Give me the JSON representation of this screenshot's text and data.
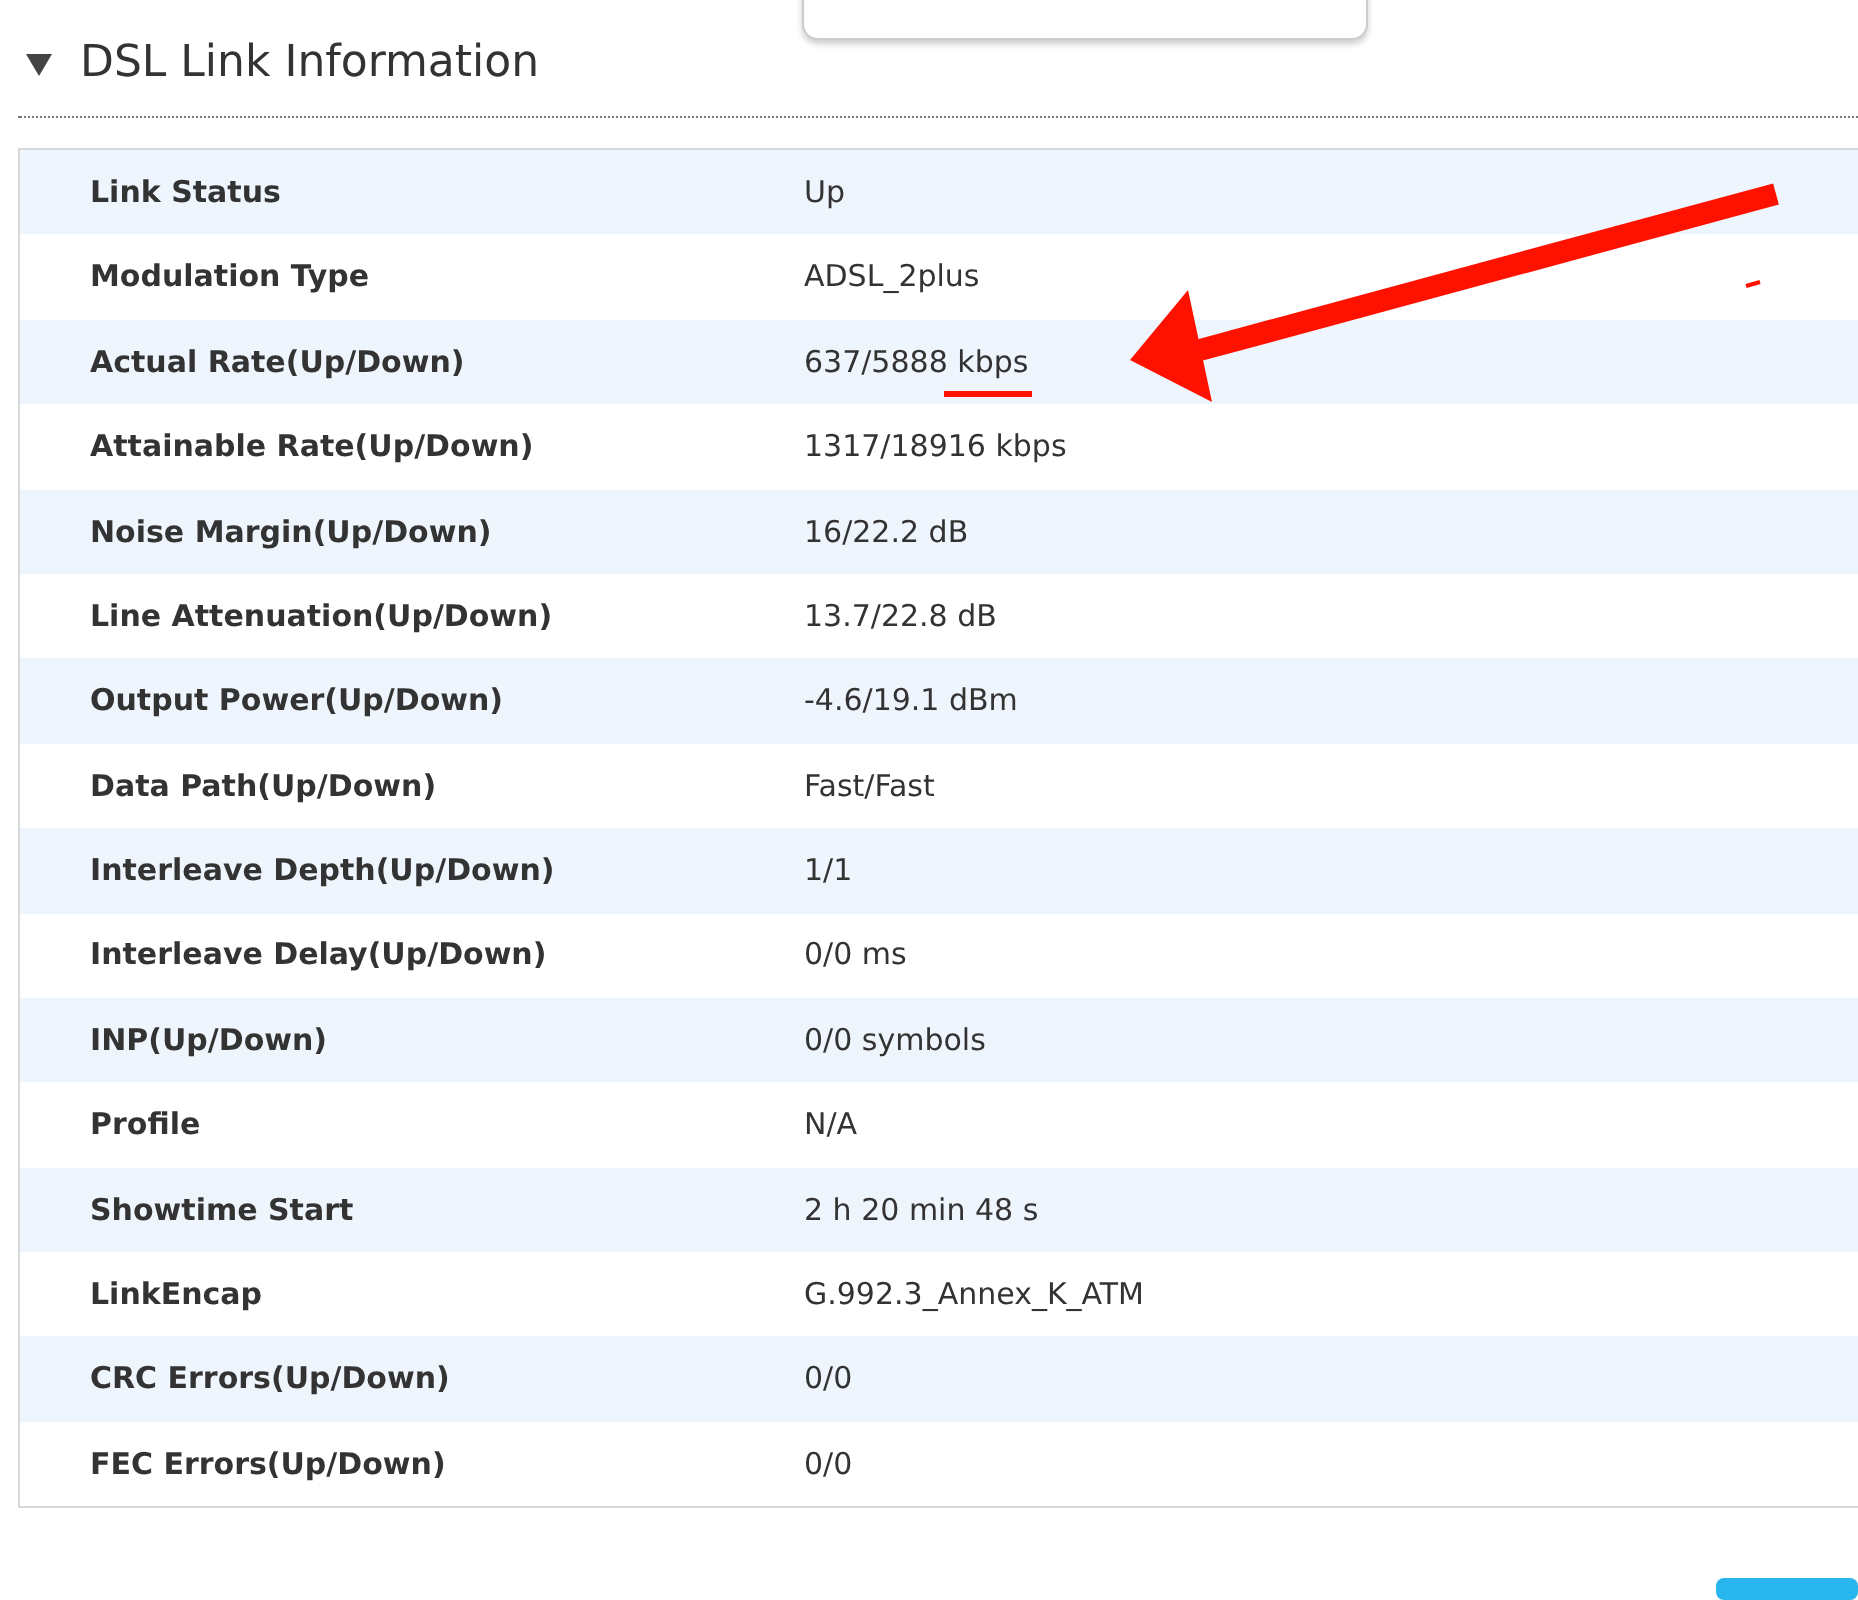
{
  "section": {
    "title": "DSL Link Information",
    "expanded": true
  },
  "rows": [
    {
      "label": "Link Status",
      "value": "Up"
    },
    {
      "label": "Modulation Type",
      "value": "ADSL_2plus"
    },
    {
      "label": "Actual Rate(Up/Down)",
      "value": "637/5888 kbps"
    },
    {
      "label": "Attainable Rate(Up/Down)",
      "value": "1317/18916 kbps"
    },
    {
      "label": "Noise Margin(Up/Down)",
      "value": "16/22.2 dB"
    },
    {
      "label": "Line Attenuation(Up/Down)",
      "value": "13.7/22.8 dB"
    },
    {
      "label": "Output Power(Up/Down)",
      "value": "-4.6/19.1 dBm"
    },
    {
      "label": "Data Path(Up/Down)",
      "value": "Fast/Fast"
    },
    {
      "label": "Interleave Depth(Up/Down)",
      "value": "1/1"
    },
    {
      "label": "Interleave Delay(Up/Down)",
      "value": "0/0 ms"
    },
    {
      "label": "INP(Up/Down)",
      "value": "0/0 symbols"
    },
    {
      "label": "Profile",
      "value": "N/A"
    },
    {
      "label": "Showtime Start",
      "value": "2 h 20 min 48 s"
    },
    {
      "label": "LinkEncap",
      "value": "G.992.3_Annex_K_ATM"
    },
    {
      "label": "CRC Errors(Up/Down)",
      "value": "0/0"
    },
    {
      "label": "FEC Errors(Up/Down)",
      "value": "0/0"
    }
  ]
}
